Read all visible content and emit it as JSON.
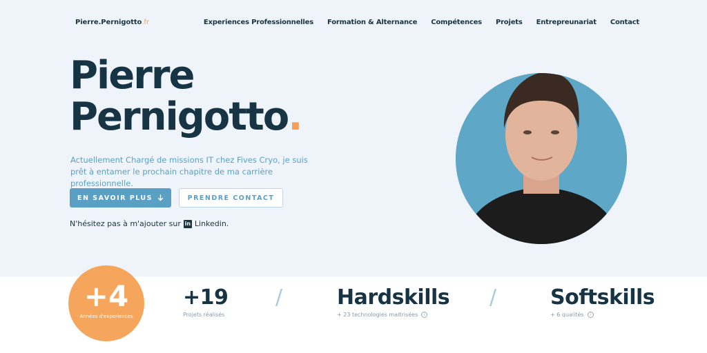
{
  "header": {
    "logo_main": "Pierre.Pernigotto",
    "logo_tld": ".fr",
    "nav": [
      "Experiences Professionnelles",
      "Formation & Alternance",
      "Compétences",
      "Projets",
      "Entrepreunariat",
      "Contact"
    ]
  },
  "hero": {
    "title_line1": "Pierre",
    "title_line2": "Pernigotto",
    "title_dot": ".",
    "description": "Actuellement Chargé de missions IT chez Fives Cryo, je suis prêt à entamer le prochain chapitre de ma carrière professionnelle.",
    "primary_button": "EN SAVOIR PLUS",
    "secondary_button": "PRENDRE CONTACT",
    "linkedin_prefix": "N'hésitez pas à m'ajouter sur",
    "linkedin_icon_text": "in",
    "linkedin_label": "Linkedin."
  },
  "stats": {
    "badge_value": "+4",
    "badge_caption": "Années d'experiences",
    "items": [
      {
        "value": "+19",
        "sub": "Projets réalisés"
      },
      {
        "value": "Hardskills",
        "sub": "+ 23 technologies maitrisées"
      },
      {
        "value": "Softskills",
        "sub": "+ 6 qualités"
      }
    ],
    "separator": "/"
  },
  "colors": {
    "accent": "#5aa0c4",
    "orange": "#f5a55c",
    "dark": "#173444",
    "hero_bg": "#eef4fa"
  }
}
